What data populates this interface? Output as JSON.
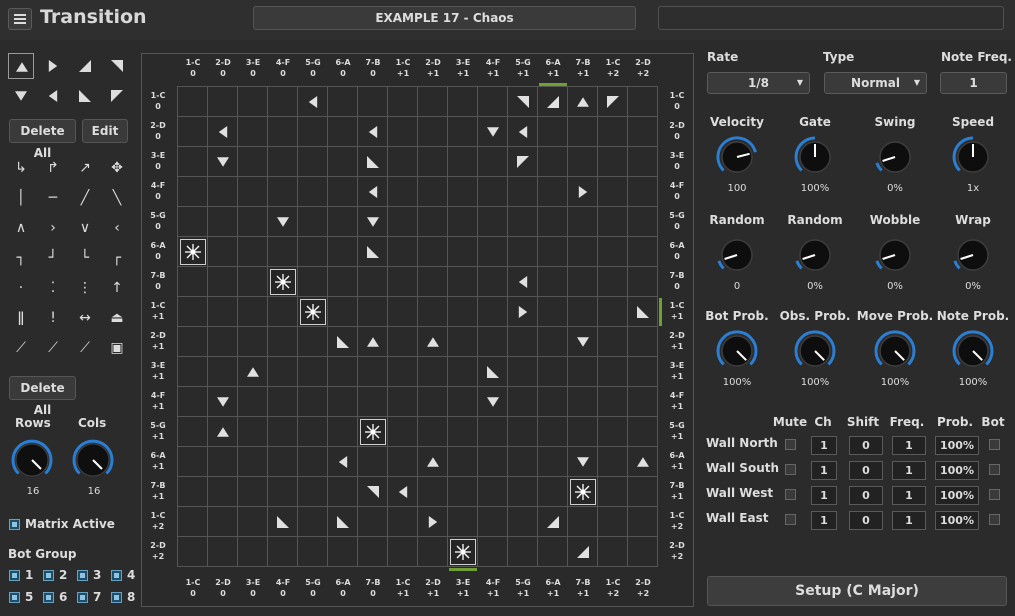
{
  "app": {
    "title": "Transition",
    "preset": "EXAMPLE 17 - Chaos"
  },
  "palette": {
    "buttons": {
      "delete_all": "Delete All",
      "edit": "Edit",
      "delete_all_2": "Delete All"
    },
    "rows_label": "Rows",
    "cols_label": "Cols",
    "rows": "16",
    "cols": "16",
    "matrix_active": "Matrix Active",
    "bot_group": "Bot Group",
    "groups": [
      "1",
      "2",
      "3",
      "4",
      "5",
      "6",
      "7",
      "8"
    ]
  },
  "grid": {
    "col_headers": [
      [
        "1-C",
        "0"
      ],
      [
        "2-D",
        "0"
      ],
      [
        "3-E",
        "0"
      ],
      [
        "4-F",
        "0"
      ],
      [
        "5-G",
        "0"
      ],
      [
        "6-A",
        "0"
      ],
      [
        "7-B",
        "0"
      ],
      [
        "1-C",
        "+1"
      ],
      [
        "2-D",
        "+1"
      ],
      [
        "3-E",
        "+1"
      ],
      [
        "4-F",
        "+1"
      ],
      [
        "5-G",
        "+1"
      ],
      [
        "6-A",
        "+1"
      ],
      [
        "7-B",
        "+1"
      ],
      [
        "1-C",
        "+2"
      ],
      [
        "2-D",
        "+2"
      ]
    ],
    "row_headers": [
      [
        "1-C",
        "0"
      ],
      [
        "2-D",
        "0"
      ],
      [
        "3-E",
        "0"
      ],
      [
        "4-F",
        "0"
      ],
      [
        "5-G",
        "0"
      ],
      [
        "6-A",
        "0"
      ],
      [
        "7-B",
        "0"
      ],
      [
        "1-C",
        "+1"
      ],
      [
        "2-D",
        "+1"
      ],
      [
        "3-E",
        "+1"
      ],
      [
        "4-F",
        "+1"
      ],
      [
        "5-G",
        "+1"
      ],
      [
        "6-A",
        "+1"
      ],
      [
        "7-B",
        "+1"
      ],
      [
        "1-C",
        "+2"
      ],
      [
        "2-D",
        "+2"
      ]
    ],
    "cells": [
      {
        "r": 0,
        "c": 4,
        "t": "left"
      },
      {
        "r": 0,
        "c": 11,
        "t": "down-right"
      },
      {
        "r": 0,
        "c": 12,
        "t": "up-right"
      },
      {
        "r": 0,
        "c": 13,
        "t": "up"
      },
      {
        "r": 0,
        "c": 14,
        "t": "up-left"
      },
      {
        "r": 1,
        "c": 1,
        "t": "left"
      },
      {
        "r": 1,
        "c": 6,
        "t": "left"
      },
      {
        "r": 1,
        "c": 10,
        "t": "down"
      },
      {
        "r": 1,
        "c": 11,
        "t": "left"
      },
      {
        "r": 2,
        "c": 1,
        "t": "down"
      },
      {
        "r": 2,
        "c": 6,
        "t": "down-left"
      },
      {
        "r": 2,
        "c": 11,
        "t": "up-left"
      },
      {
        "r": 3,
        "c": 6,
        "t": "left"
      },
      {
        "r": 3,
        "c": 13,
        "t": "right"
      },
      {
        "r": 4,
        "c": 3,
        "t": "down"
      },
      {
        "r": 4,
        "c": 6,
        "t": "down"
      },
      {
        "r": 5,
        "c": 0,
        "t": "burst"
      },
      {
        "r": 5,
        "c": 6,
        "t": "down-left"
      },
      {
        "r": 6,
        "c": 3,
        "t": "burst"
      },
      {
        "r": 6,
        "c": 11,
        "t": "left"
      },
      {
        "r": 7,
        "c": 4,
        "t": "burst"
      },
      {
        "r": 7,
        "c": 11,
        "t": "right"
      },
      {
        "r": 7,
        "c": 15,
        "t": "down-left"
      },
      {
        "r": 8,
        "c": 5,
        "t": "down-left"
      },
      {
        "r": 8,
        "c": 6,
        "t": "up"
      },
      {
        "r": 8,
        "c": 8,
        "t": "up"
      },
      {
        "r": 8,
        "c": 13,
        "t": "down"
      },
      {
        "r": 9,
        "c": 2,
        "t": "up"
      },
      {
        "r": 9,
        "c": 10,
        "t": "down-left"
      },
      {
        "r": 10,
        "c": 1,
        "t": "down"
      },
      {
        "r": 10,
        "c": 10,
        "t": "down"
      },
      {
        "r": 11,
        "c": 1,
        "t": "up"
      },
      {
        "r": 11,
        "c": 6,
        "t": "burst"
      },
      {
        "r": 12,
        "c": 5,
        "t": "left"
      },
      {
        "r": 12,
        "c": 8,
        "t": "up"
      },
      {
        "r": 12,
        "c": 13,
        "t": "down"
      },
      {
        "r": 12,
        "c": 15,
        "t": "up"
      },
      {
        "r": 13,
        "c": 6,
        "t": "down-right"
      },
      {
        "r": 13,
        "c": 7,
        "t": "left"
      },
      {
        "r": 13,
        "c": 13,
        "t": "burst"
      },
      {
        "r": 14,
        "c": 3,
        "t": "down-left"
      },
      {
        "r": 14,
        "c": 5,
        "t": "down-left"
      },
      {
        "r": 14,
        "c": 8,
        "t": "right"
      },
      {
        "r": 14,
        "c": 12,
        "t": "up-right"
      },
      {
        "r": 15,
        "c": 9,
        "t": "burst"
      },
      {
        "r": 15,
        "c": 13,
        "t": "up-right"
      }
    ]
  },
  "controls": {
    "rate_label": "Rate",
    "rate": "1/8",
    "type_label": "Type",
    "type": "Normal",
    "notefreq_label": "Note Freq.",
    "notefreq": "1",
    "knobs": [
      {
        "label": "Velocity",
        "value": "100",
        "level": 0.78
      },
      {
        "label": "Gate",
        "value": "100%",
        "level": 0.5
      },
      {
        "label": "Swing",
        "value": "0%",
        "level": 0.1
      },
      {
        "label": "Speed",
        "value": "1x",
        "level": 0.5
      },
      {
        "label": "Random",
        "value": "0",
        "level": 0.1
      },
      {
        "label": "Random",
        "value": "0%",
        "level": 0.1
      },
      {
        "label": "Wobble",
        "value": "0%",
        "level": 0.1
      },
      {
        "label": "Wrap",
        "value": "0%",
        "level": 0.1
      },
      {
        "label": "Bot Prob.",
        "value": "100%",
        "level": 1
      },
      {
        "label": "Obs. Prob.",
        "value": "100%",
        "level": 1
      },
      {
        "label": "Move Prob.",
        "value": "100%",
        "level": 1
      },
      {
        "label": "Note Prob.",
        "value": "100%",
        "level": 1
      }
    ],
    "wall_headers": [
      "Mute",
      "Ch",
      "Shift",
      "Freq.",
      "Prob.",
      "Bot"
    ],
    "walls": [
      {
        "name": "Wall North",
        "ch": "1",
        "shift": "0",
        "freq": "1",
        "prob": "100%"
      },
      {
        "name": "Wall South",
        "ch": "1",
        "shift": "0",
        "freq": "1",
        "prob": "100%"
      },
      {
        "name": "Wall West",
        "ch": "1",
        "shift": "0",
        "freq": "1",
        "prob": "100%"
      },
      {
        "name": "Wall East",
        "ch": "1",
        "shift": "0",
        "freq": "1",
        "prob": "100%"
      }
    ],
    "setup": "Setup (C Major)"
  },
  "colors": {
    "accent_blue": "#2a7fd4",
    "green": "#6ea033"
  }
}
